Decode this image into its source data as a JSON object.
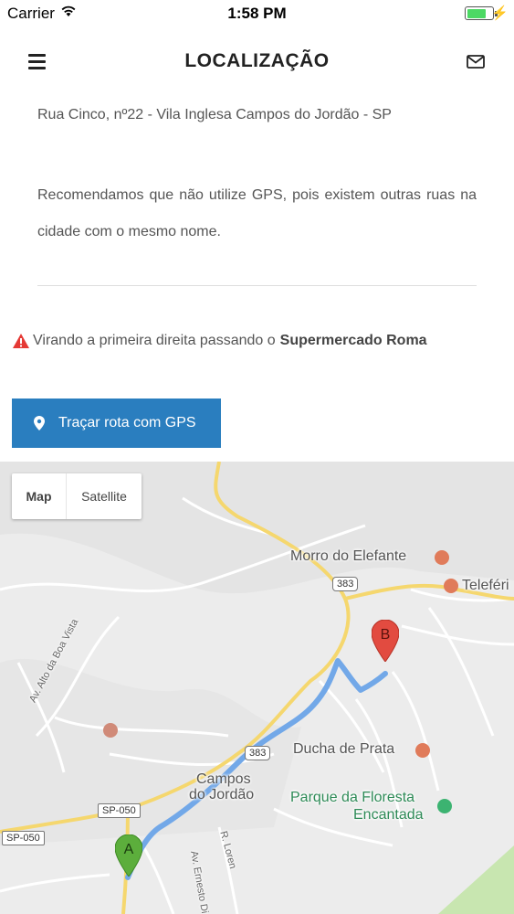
{
  "status_bar": {
    "carrier": "Carrier",
    "time": "1:58 PM",
    "battery_level": 0.8
  },
  "header": {
    "title": "LOCALIZAÇÃO"
  },
  "content": {
    "address": "Rua Cinco, nº22 - Vila Inglesa Campos do Jordão - SP",
    "gps_note": "Recomendamos que não utilize GPS, pois existem outras ruas na cidade com o mesmo nome.",
    "warning_text": "Virando a primeira direita passando o",
    "warning_place": "Supermercado Roma",
    "route_button": "Traçar rota com GPS"
  },
  "map": {
    "type_buttons": {
      "map": "Map",
      "satellite": "Satellite"
    },
    "labels": {
      "morro": "Morro do Elefante",
      "teleferico": "Teleféri",
      "ducha": "Ducha de Prata",
      "campos_1": "Campos",
      "campos_2": "do Jordão",
      "parque_1": "Parque da Floresta",
      "parque_2": "Encantada",
      "boa_vista": "Av. Alto da Boa Vista",
      "ernesto": "Av. Ernesto Di",
      "loren": "R. Loren"
    },
    "shields": {
      "r383_top": "383",
      "r383_mid": "383",
      "sp050_a": "SP-050",
      "sp050_b": "SP-050"
    },
    "markers": {
      "start": "A",
      "end": "B"
    },
    "colors": {
      "route": "#72a8e8",
      "marker_a": "#5cae3c",
      "marker_b": "#e24b40",
      "road_yellow": "#f5d76e",
      "park": "#c8e6b0"
    }
  },
  "icons": {
    "menu": "hamburger-icon",
    "mail": "envelope-icon",
    "warning": "warning-triangle-icon",
    "pin": "map-pin-icon",
    "wifi": "wifi-icon"
  }
}
